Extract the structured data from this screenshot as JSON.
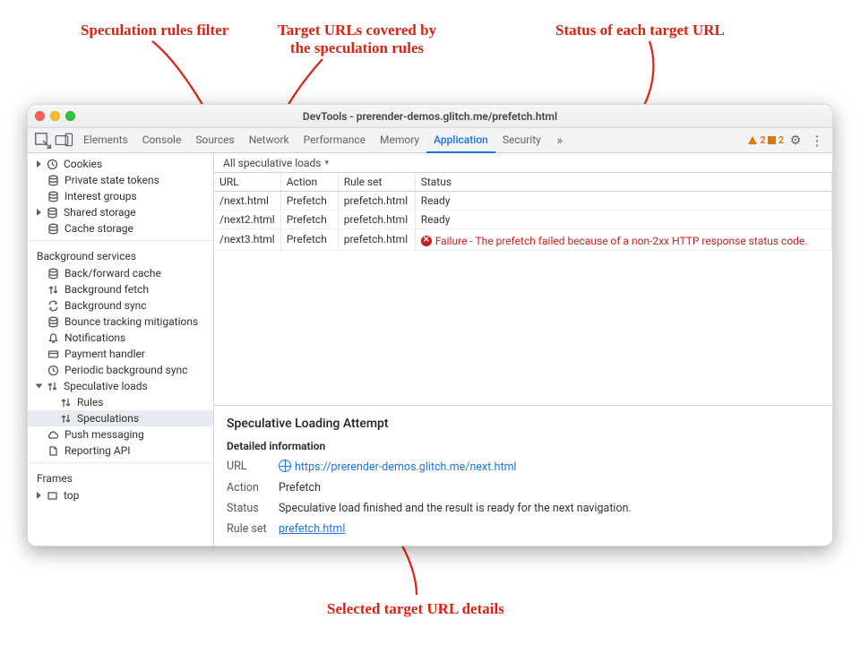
{
  "annotations": {
    "filter": "Speculation rules filter",
    "targets": "Target URLs covered by\nthe speculation rules",
    "status": "Status of each target URL",
    "details": "Selected target URL details"
  },
  "window": {
    "title": "DevTools - prerender-demos.glitch.me/prefetch.html"
  },
  "toolbar": {
    "tabs": [
      "Elements",
      "Console",
      "Sources",
      "Network",
      "Performance",
      "Memory",
      "Application",
      "Security"
    ],
    "activeTab": "Application",
    "overflow": "»",
    "warnCount": "2",
    "msgCount": "2"
  },
  "sidebar": {
    "storage_first": [
      {
        "label": "Cookies",
        "icon": "clock",
        "caret": true
      },
      {
        "label": "Private state tokens",
        "icon": "db"
      },
      {
        "label": "Interest groups",
        "icon": "db"
      },
      {
        "label": "Shared storage",
        "icon": "db",
        "caret": true
      },
      {
        "label": "Cache storage",
        "icon": "db"
      }
    ],
    "bg_title": "Background services",
    "bg": [
      {
        "label": "Back/forward cache",
        "icon": "db"
      },
      {
        "label": "Background fetch",
        "icon": "updown"
      },
      {
        "label": "Background sync",
        "icon": "sync"
      },
      {
        "label": "Bounce tracking mitigations",
        "icon": "db"
      },
      {
        "label": "Notifications",
        "icon": "bell"
      },
      {
        "label": "Payment handler",
        "icon": "card"
      },
      {
        "label": "Periodic background sync",
        "icon": "clock"
      },
      {
        "label": "Speculative loads",
        "icon": "updown",
        "expanded": true,
        "children": [
          {
            "label": "Rules"
          },
          {
            "label": "Speculations",
            "selected": true
          }
        ]
      },
      {
        "label": "Push messaging",
        "icon": "cloud"
      },
      {
        "label": "Reporting API",
        "icon": "file"
      }
    ],
    "frames_title": "Frames",
    "frames": [
      {
        "label": "top",
        "icon": "rect",
        "caret": true
      }
    ]
  },
  "filter_label": "All speculative loads",
  "grid": {
    "headers": [
      "URL",
      "Action",
      "Rule set",
      "Status"
    ],
    "rows": [
      {
        "url": "/next.html",
        "action": "Prefetch",
        "ruleset": "prefetch.html",
        "status": "Ready",
        "fail": false
      },
      {
        "url": "/next2.html",
        "action": "Prefetch",
        "ruleset": "prefetch.html",
        "status": "Ready",
        "fail": false
      },
      {
        "url": "/next3.html",
        "action": "Prefetch",
        "ruleset": "prefetch.html",
        "status": "Failure - The prefetch failed because of a non-2xx HTTP response status code.",
        "fail": true
      }
    ]
  },
  "detail": {
    "title": "Speculative Loading Attempt",
    "subheading": "Detailed information",
    "url_label": "URL",
    "url_value": "https://prerender-demos.glitch.me/next.html",
    "action_label": "Action",
    "action_value": "Prefetch",
    "status_label": "Status",
    "status_value": "Speculative load finished and the result is ready for the next navigation.",
    "ruleset_label": "Rule set",
    "ruleset_value": "prefetch.html"
  }
}
